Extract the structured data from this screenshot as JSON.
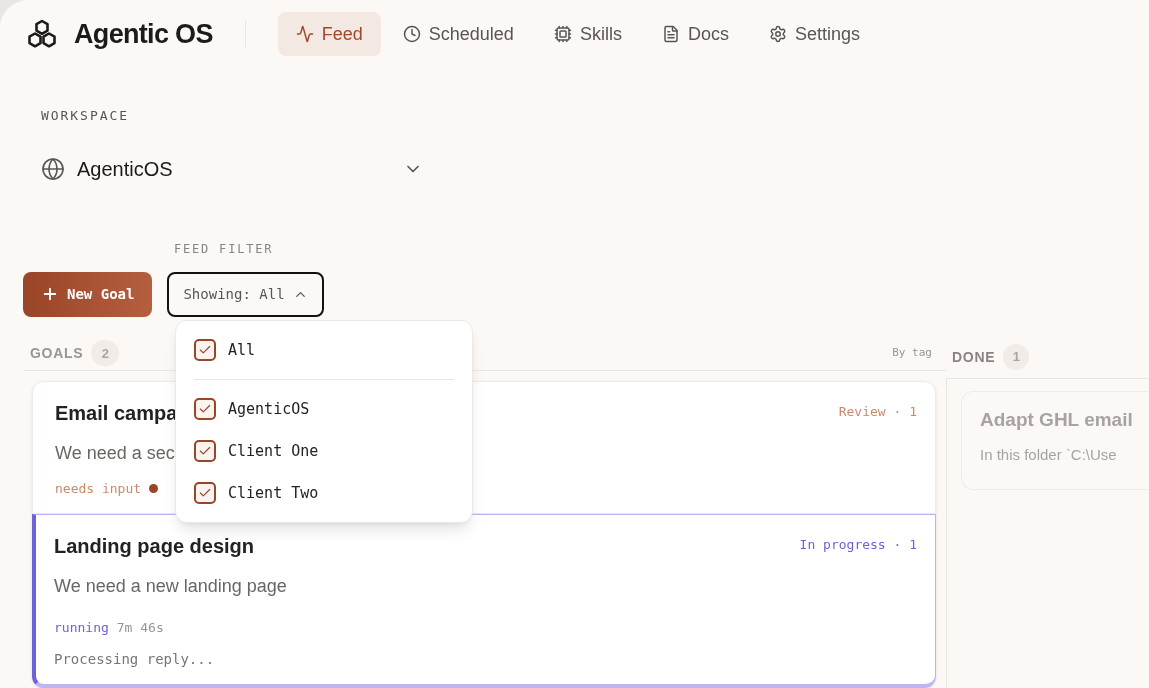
{
  "app": {
    "name": "Agentic OS"
  },
  "nav": [
    {
      "label": "Feed",
      "selected": true
    },
    {
      "label": "Scheduled",
      "selected": false
    },
    {
      "label": "Skills",
      "selected": false
    },
    {
      "label": "Docs",
      "selected": false
    },
    {
      "label": "Settings",
      "selected": false
    }
  ],
  "workspace": {
    "label": "WORKSPACE",
    "value": "AgenticOS"
  },
  "feed_filter": {
    "label": "FEED FILTER",
    "button": "Showing: All",
    "expanded": true,
    "options": [
      {
        "label": "All",
        "checked": true
      },
      {
        "label": "AgenticOS",
        "checked": true
      },
      {
        "label": "Client One",
        "checked": true
      },
      {
        "label": "Client Two",
        "checked": true
      }
    ]
  },
  "new_goal": "New Goal",
  "goals": {
    "title": "GOALS",
    "count": "2",
    "group_by": "By tag",
    "cards": [
      {
        "kind": "review",
        "title": "Email campa",
        "description": "We need a sec",
        "badge": "Review · 1",
        "status": "needs input",
        "attention": true
      },
      {
        "kind": "progress",
        "title": "Landing page design",
        "description": "We need a new landing page",
        "badge": "In progress · 1",
        "status": "running",
        "elapsed": "7m 46s",
        "activity": "Processing reply..."
      }
    ]
  },
  "done": {
    "title": "DONE",
    "count": "1",
    "cards": [
      {
        "title": "Adapt GHL email",
        "description": "In this folder `C:\\Use"
      }
    ]
  }
}
